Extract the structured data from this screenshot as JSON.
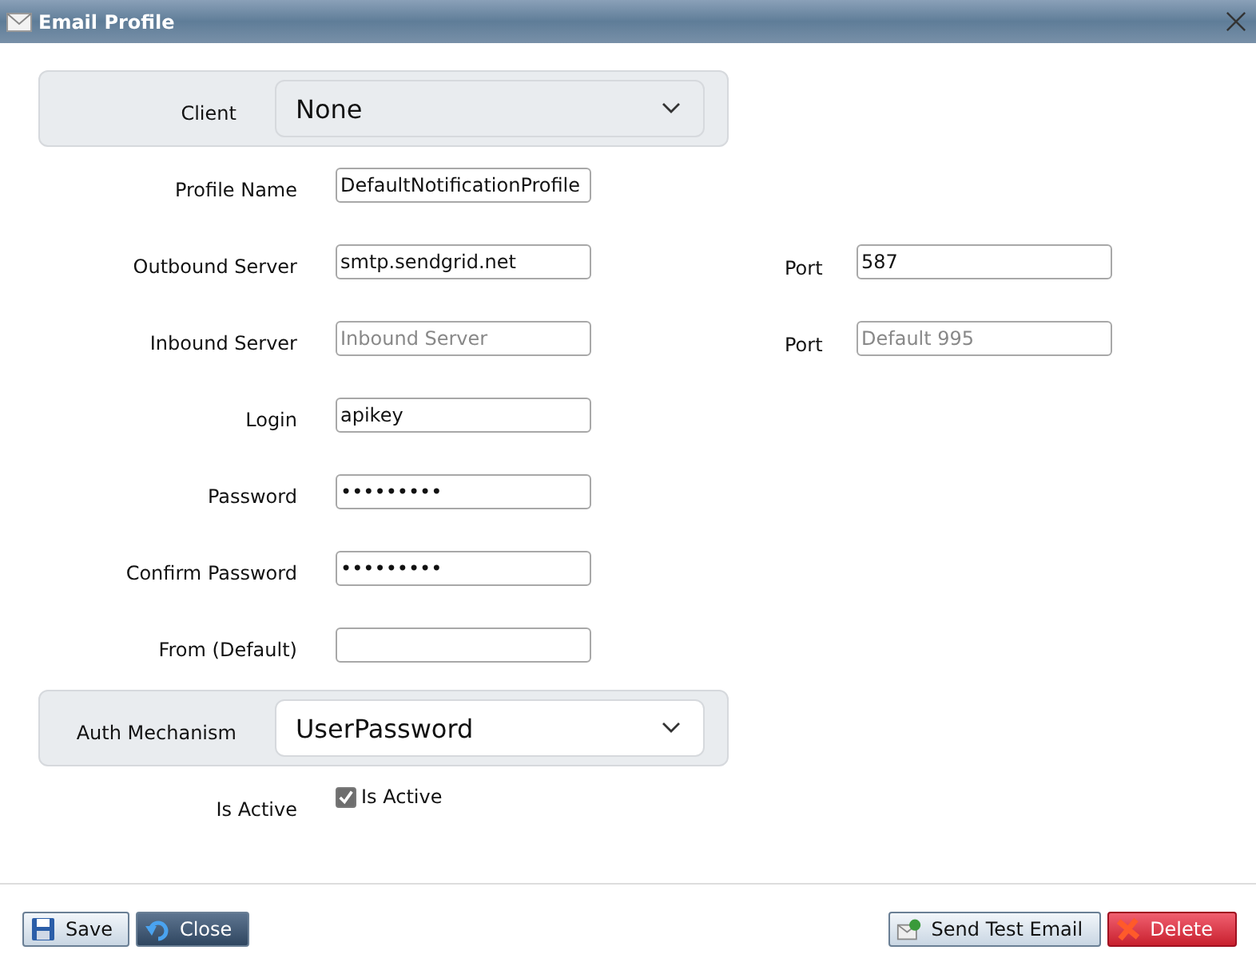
{
  "window": {
    "title": "Email Profile"
  },
  "fields": [
    {
      "kind": "select",
      "label": "Client",
      "value": "None"
    },
    {
      "kind": "text",
      "label": "Profile Name",
      "value": "DefaultNotificationProfile"
    },
    {
      "kind": "text",
      "label": "Outbound Server",
      "value": "smtp.sendgrid.net",
      "port": {
        "label": "Port",
        "value": "587"
      }
    },
    {
      "kind": "text",
      "label": "Inbound Server",
      "placeholder": "Inbound Server",
      "port": {
        "label": "Port",
        "placeholder": "Default 995"
      }
    },
    {
      "kind": "text",
      "label": "Login",
      "value": "apikey"
    },
    {
      "kind": "text",
      "label": "Password",
      "value": "•••••••••"
    },
    {
      "kind": "text",
      "label": "Confirm Password",
      "value": "•••••••••"
    },
    {
      "kind": "text",
      "label": "From (Default)"
    },
    {
      "kind": "select",
      "label": "Auth Mechanism",
      "value": "UserPassword"
    },
    {
      "kind": "checkbox",
      "label": "Is Active",
      "text": "Is Active",
      "checked": true
    }
  ],
  "buttons": [
    {
      "kind": "save",
      "label": "Save"
    },
    {
      "kind": "close",
      "label": "Close"
    },
    {
      "kind": "test",
      "label": "Send Test Email"
    },
    {
      "kind": "delete",
      "label": "Delete"
    }
  ]
}
